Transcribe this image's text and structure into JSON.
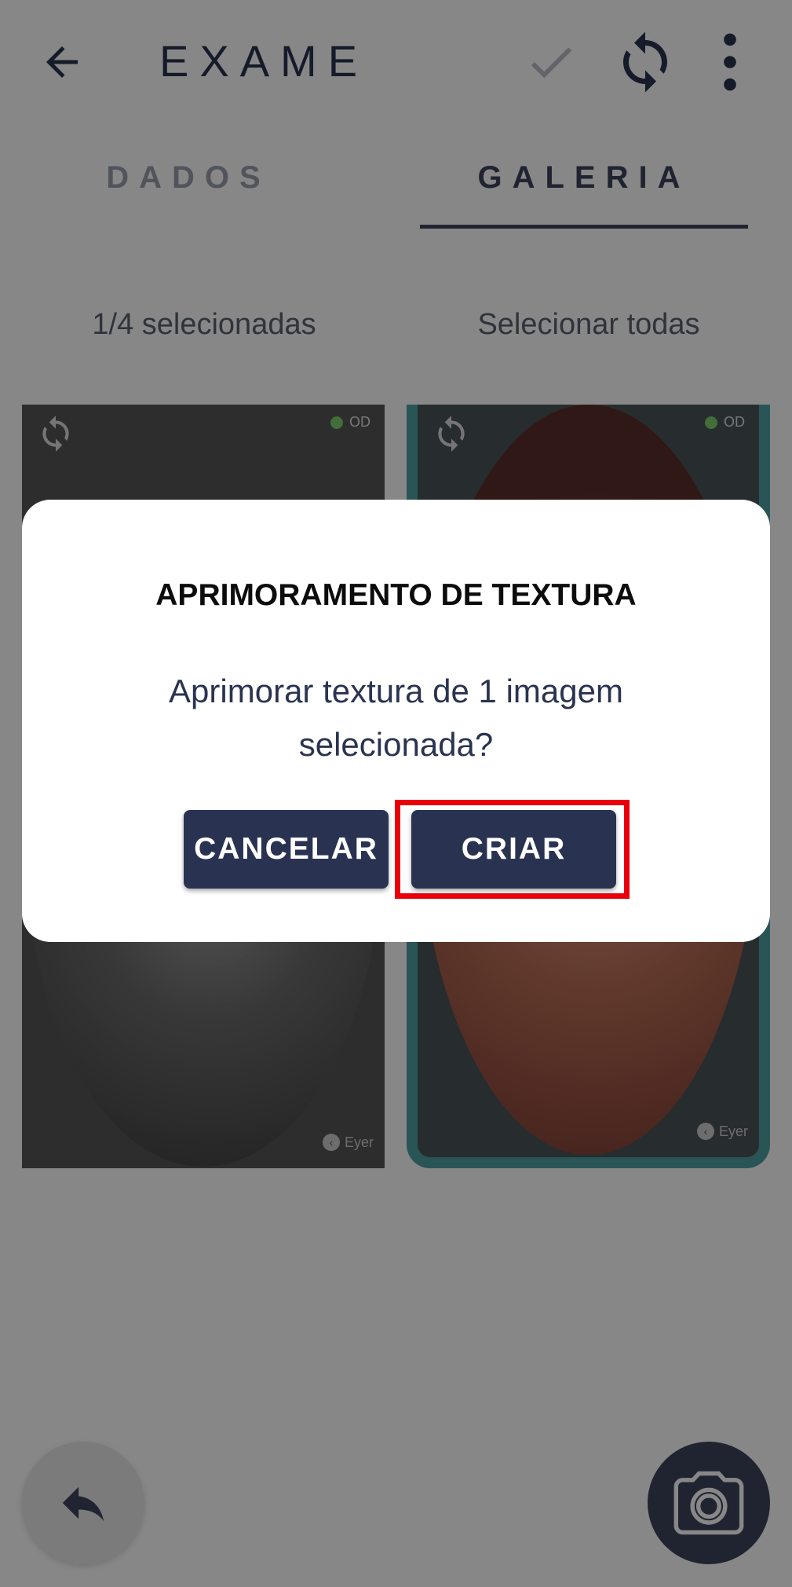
{
  "header": {
    "title": "EXAME",
    "back_icon": "arrow-left-icon",
    "confirm_icon": "check-icon",
    "sync_icon": "sync-icon",
    "menu_icon": "more-vertical-icon"
  },
  "tabs": [
    {
      "label": "DADOS",
      "active": false
    },
    {
      "label": "GALERIA",
      "active": true
    }
  ],
  "selection": {
    "count_text": "1/4 selecionadas",
    "select_all": "Selecionar todas"
  },
  "gallery": {
    "items": [
      {
        "eye": "OD",
        "style": "grayscale",
        "watermark": "Eyer",
        "selected": false
      },
      {
        "eye": "OD",
        "style": "color",
        "watermark": "Eyer",
        "selected": true
      }
    ]
  },
  "dialog": {
    "title": "APRIMORAMENTO DE TEXTURA",
    "message": "Aprimorar textura de 1 imagem selecionada?",
    "cancel_label": "CANCELAR",
    "confirm_label": "CRIAR"
  },
  "fab": {
    "undo_icon": "undo-icon",
    "camera_icon": "camera-icon"
  },
  "colors": {
    "primary": "#293351",
    "selected_border": "#4ea1a3",
    "highlight": "#e8000b",
    "od_indicator": "#7fcf6c"
  }
}
